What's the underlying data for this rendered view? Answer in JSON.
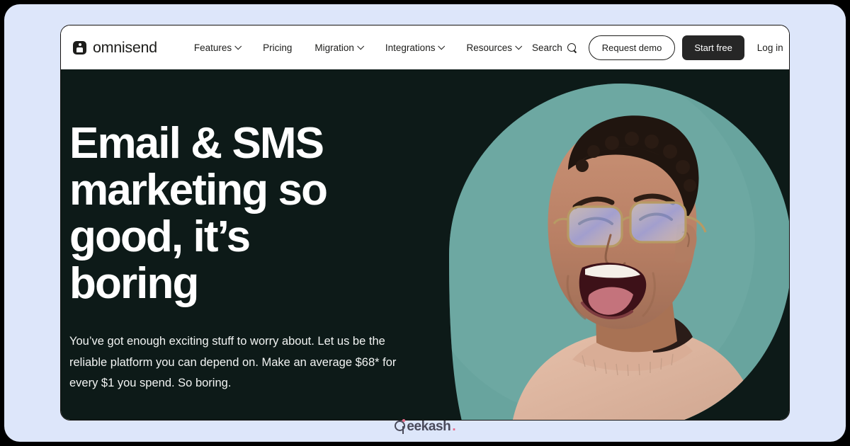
{
  "brand": {
    "logo_text": "omnisend",
    "logo_icon": "omnisend-mark-icon"
  },
  "nav": {
    "items": [
      {
        "label": "Features",
        "has_dropdown": true
      },
      {
        "label": "Pricing",
        "has_dropdown": false
      },
      {
        "label": "Migration",
        "has_dropdown": true
      },
      {
        "label": "Integrations",
        "has_dropdown": true
      },
      {
        "label": "Resources",
        "has_dropdown": true
      }
    ],
    "search_label": "Search",
    "search_icon": "search-icon",
    "request_demo_label": "Request demo",
    "start_free_label": "Start free",
    "login_label": "Log in"
  },
  "hero": {
    "headline": "Email & SMS\nmarketing so\ngood, it’s\nboring",
    "subcopy": "You’ve got enough exciting stuff to worry about. Let us be the reliable platform you can depend on. Make an average $68* for every $1 you spend. So boring.",
    "photo_alt": "laughing-man-with-glasses-photo"
  },
  "watermark": {
    "text": "eekash",
    "period": ".",
    "full": "geekash."
  },
  "colors": {
    "page_background": "#dde6fa",
    "frame": "#000000",
    "nav_background": "#ffffff",
    "hero_background": "#0d1a18",
    "teal_circle": "#68a49e",
    "text_dark": "#1d1d1b",
    "button_dark": "#262626",
    "watermark_gray": "#4a4a5a",
    "watermark_accent": "#e86a8a"
  }
}
